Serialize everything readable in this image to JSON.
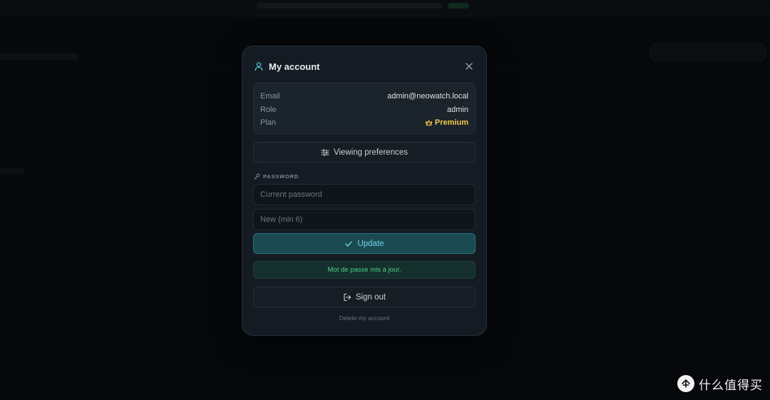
{
  "modal": {
    "title": "My account",
    "info": {
      "email_label": "Email",
      "email_value": "admin@neowatch.local",
      "role_label": "Role",
      "role_value": "admin",
      "plan_label": "Plan",
      "plan_value": "Premium"
    },
    "preferences_label": "Viewing preferences",
    "password_section_label": "PASSWORD",
    "current_password_placeholder": "Current password",
    "new_password_placeholder": "New (min 6)",
    "update_label": "Update",
    "success_message": "Mot de passe mis à jour.",
    "sign_out_label": "Sign out",
    "delete_account_label": "Delete my account"
  },
  "watermark": {
    "text": "什么值得买"
  },
  "colors": {
    "accent": "#6fd3e6",
    "premium": "#f2c94c",
    "success": "#4cd08a"
  }
}
